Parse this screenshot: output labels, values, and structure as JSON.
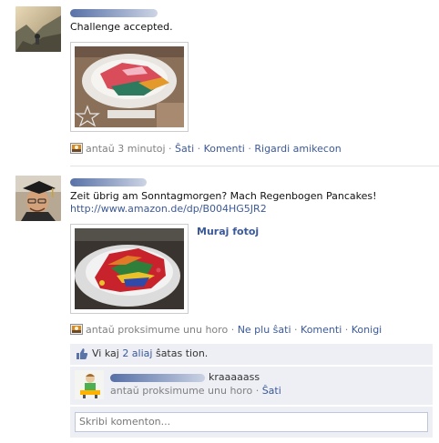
{
  "post1": {
    "message": "Challenge accepted.",
    "meta": {
      "time": "antaŭ 3 minutoj",
      "like": "Ŝati",
      "comment": "Komenti",
      "view_friendship": "Rigardi amikecon",
      "sep": "·"
    }
  },
  "post2": {
    "message": "Zeit übrig am Sonntagmorgen? Mach Regenbogen Pancakes!",
    "link": "http://www.amazon.de/dp/B004HG5JR2",
    "photo_action": "Muraj fotoj",
    "meta": {
      "time": "antaŭ proksimume unu horo",
      "unlike": "Ne plu ŝati",
      "comment": "Komenti",
      "share": "Konigi",
      "sep": "·"
    },
    "likes": {
      "prefix": "Vi kaj ",
      "count_link": "2 aliaj",
      "suffix": " ŝatas tion."
    },
    "comment": {
      "text": "kraaaaass",
      "time": "antaŭ proksimume unu horo",
      "like": "Ŝati",
      "sep": "·"
    },
    "comment_input": {
      "placeholder": "Skribi komenton..."
    }
  },
  "colors": {
    "link": "#3b5998",
    "meta": "#808080",
    "ufi_background": "#edeff4"
  },
  "icons": {
    "post_type": "photo-story-icon",
    "like": "thumbs-up-icon"
  }
}
